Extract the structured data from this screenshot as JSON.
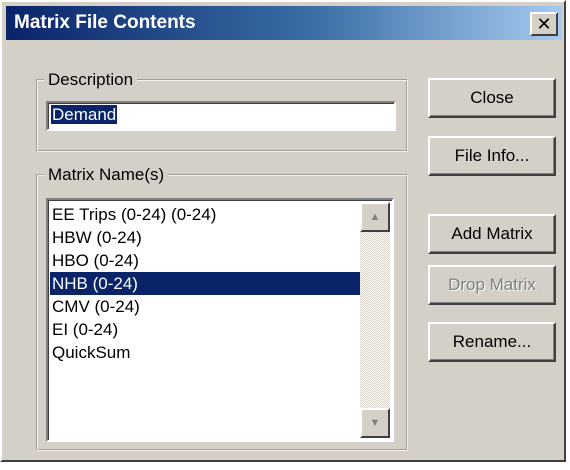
{
  "window": {
    "title": "Matrix File Contents",
    "close_glyph": "✕"
  },
  "description": {
    "legend": "Description",
    "value": "Demand"
  },
  "matrix_names": {
    "legend": "Matrix Name(s)",
    "items": [
      {
        "label": "EE Trips (0-24) (0-24)",
        "selected": false
      },
      {
        "label": "HBW (0-24)",
        "selected": false
      },
      {
        "label": "HBO (0-24)",
        "selected": false
      },
      {
        "label": "NHB (0-24)",
        "selected": true
      },
      {
        "label": "CMV (0-24)",
        "selected": false
      },
      {
        "label": "EI (0-24)",
        "selected": false
      },
      {
        "label": "QuickSum",
        "selected": false
      }
    ],
    "scroll_up_icon": "▲",
    "scroll_down_icon": "▼"
  },
  "buttons": {
    "close": "Close",
    "file_info": "File Info...",
    "add_matrix": "Add Matrix",
    "drop_matrix": "Drop Matrix",
    "rename": "Rename..."
  },
  "colors": {
    "title_gradient_start": "#0a246a",
    "title_gradient_end": "#a6caf0",
    "face": "#d4d0c8",
    "selection": "#0a246a"
  }
}
